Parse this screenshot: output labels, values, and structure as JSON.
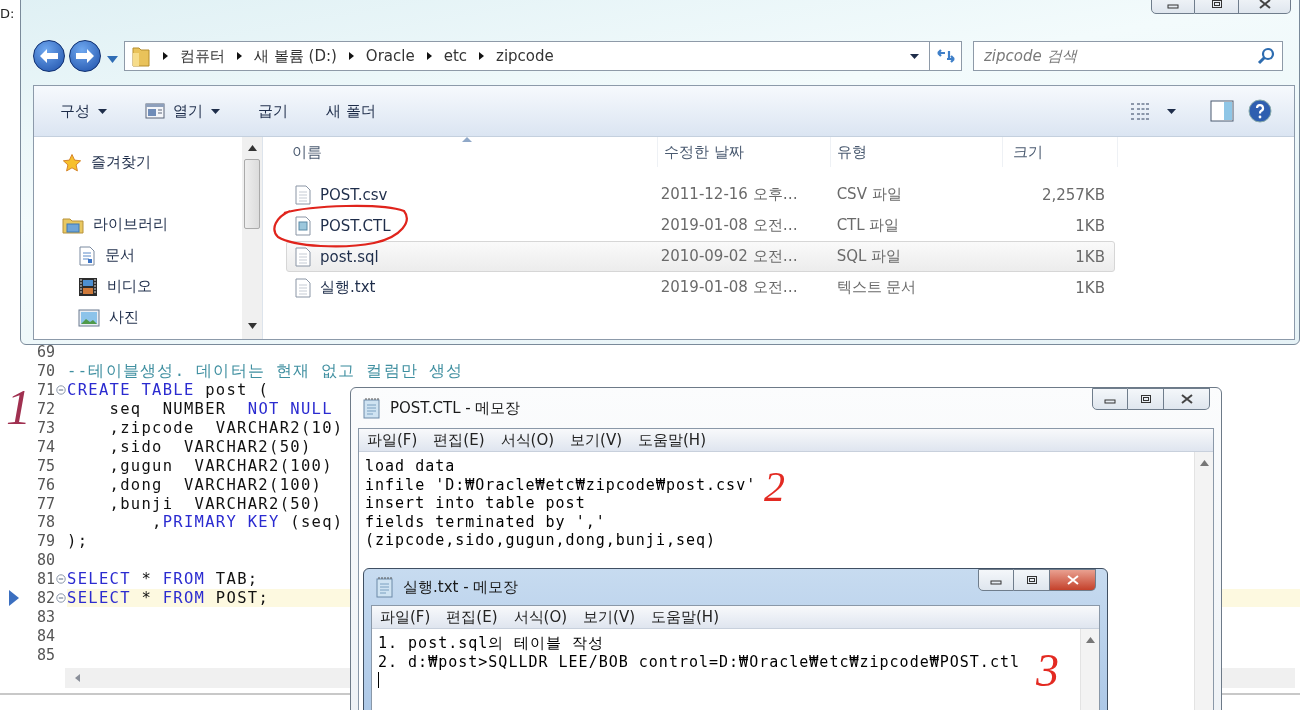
{
  "editor": {
    "title": "D:",
    "lines": [
      {
        "number": "69",
        "fold": false,
        "current": false
      },
      {
        "number": "70",
        "fold": false,
        "current": false,
        "tokens": [
          {
            "kind": "comment",
            "text": "--테이블생성. 데이터는 현재 없고 컬럼만 생성"
          }
        ]
      },
      {
        "number": "71",
        "fold": true,
        "current": false,
        "tokens": [
          {
            "kind": "kw",
            "text": "CREATE TABLE"
          },
          {
            "kind": "plain",
            "text": " post ("
          }
        ]
      },
      {
        "number": "72",
        "fold": false,
        "current": false,
        "tokens": [
          {
            "kind": "plain",
            "text": "    seq  NUMBER  "
          },
          {
            "kind": "kw",
            "text": "NOT NULL"
          }
        ]
      },
      {
        "number": "73",
        "fold": false,
        "current": false,
        "tokens": [
          {
            "kind": "plain",
            "text": "    ,zipcode  VARCHAR2(10)"
          }
        ]
      },
      {
        "number": "74",
        "fold": false,
        "current": false,
        "tokens": [
          {
            "kind": "plain",
            "text": "    ,sido  VARCHAR2(50)"
          }
        ]
      },
      {
        "number": "75",
        "fold": false,
        "current": false,
        "tokens": [
          {
            "kind": "plain",
            "text": "    ,gugun  VARCHAR2(100)"
          }
        ]
      },
      {
        "number": "76",
        "fold": false,
        "current": false,
        "tokens": [
          {
            "kind": "plain",
            "text": "    ,dong  VARCHAR2(100)"
          }
        ]
      },
      {
        "number": "77",
        "fold": false,
        "current": false,
        "tokens": [
          {
            "kind": "plain",
            "text": "    ,bunji  VARCHAR2(50)"
          }
        ]
      },
      {
        "number": "78",
        "fold": false,
        "current": false,
        "tokens": [
          {
            "kind": "plain",
            "text": "        ,"
          },
          {
            "kind": "kw",
            "text": "PRIMARY KEY"
          },
          {
            "kind": "plain",
            "text": " (seq)"
          }
        ]
      },
      {
        "number": "79",
        "fold": false,
        "current": false,
        "tokens": [
          {
            "kind": "plain",
            "text": ");"
          }
        ]
      },
      {
        "number": "80",
        "fold": false,
        "current": false
      },
      {
        "number": "81",
        "fold": true,
        "current": false,
        "tokens": [
          {
            "kind": "kw",
            "text": "SELECT"
          },
          {
            "kind": "plain",
            "text": " * "
          },
          {
            "kind": "kw",
            "text": "FROM"
          },
          {
            "kind": "plain",
            "text": " TAB;"
          }
        ]
      },
      {
        "number": "82",
        "fold": true,
        "current": true,
        "tokens": [
          {
            "kind": "kw",
            "text": "SELECT"
          },
          {
            "kind": "plain",
            "text": " * "
          },
          {
            "kind": "kw",
            "text": "FROM"
          },
          {
            "kind": "plain",
            "text": " POST;"
          }
        ]
      },
      {
        "number": "83",
        "fold": false,
        "current": false
      },
      {
        "number": "84",
        "fold": false,
        "current": false
      },
      {
        "number": "85",
        "fold": false,
        "current": false
      }
    ]
  },
  "explorer": {
    "address": [
      "컴퓨터",
      "새 볼륨 (D:)",
      "Oracle",
      "etc",
      "zipcode"
    ],
    "search": {
      "placeholder": "zipcode 검색"
    },
    "toolbar": [
      {
        "label": "구성",
        "icon": false,
        "dropdown": true
      },
      {
        "label": "열기",
        "icon": true,
        "dropdown": true
      },
      {
        "label": "굽기",
        "icon": false,
        "dropdown": false
      },
      {
        "label": "새 폴더",
        "icon": false,
        "dropdown": false
      }
    ],
    "nav": [
      {
        "label": "즐겨찾기",
        "kind": "star"
      },
      {
        "label": "라이브러리",
        "kind": "library",
        "children": [
          {
            "label": "문서",
            "kind": "document"
          },
          {
            "label": "비디오",
            "kind": "video"
          },
          {
            "label": "사진",
            "kind": "image"
          }
        ]
      }
    ],
    "columns": [
      {
        "label": "이름",
        "sorted": true
      },
      {
        "label": "수정한 날짜",
        "sorted": false
      },
      {
        "label": "유형",
        "sorted": false
      },
      {
        "label": "크기",
        "sorted": false
      }
    ],
    "files": [
      {
        "name": "POST.csv",
        "date": "2011-12-16 오후…",
        "type": "CSV 파일",
        "size": "2,257KB",
        "kind": "text",
        "selected": false
      },
      {
        "name": "POST.CTL",
        "date": "2019-01-08 오전…",
        "type": "CTL 파일",
        "size": "1KB",
        "kind": "ctl",
        "selected": false
      },
      {
        "name": "post.sql",
        "date": "2010-09-02 오전…",
        "type": "SQL 파일",
        "size": "1KB",
        "kind": "text",
        "selected": true
      },
      {
        "name": "실행.txt",
        "date": "2019-01-08 오전…",
        "type": "텍스트 문서",
        "size": "1KB",
        "kind": "text",
        "selected": false
      }
    ]
  },
  "notepads": [
    {
      "title": "POST.CTL - 메모장",
      "active": false,
      "caret": false,
      "menu": [
        "파일(F)",
        "편집(E)",
        "서식(O)",
        "보기(V)",
        "도움말(H)"
      ],
      "lines": [
        "load data",
        "infile 'D:₩Oracle₩etc₩zipcode₩post.csv'",
        "insert into table post",
        "fields terminated by ','",
        "(zipcode,sido,gugun,dong,bunji,seq)"
      ]
    },
    {
      "title": "실행.txt - 메모장",
      "active": true,
      "caret": true,
      "menu": [
        "파일(F)",
        "편집(E)",
        "서식(O)",
        "보기(V)",
        "도움말(H)"
      ],
      "lines": [
        "1. post.sql의 테이블 작성",
        "2. d:₩post>SQLLDR LEE/BOB control=D:₩Oracle₩etc₩zipcode₩POST.ctl"
      ]
    }
  ],
  "annotations": [
    {
      "text": "1"
    },
    {
      "text": "2"
    },
    {
      "text": "3"
    }
  ]
}
